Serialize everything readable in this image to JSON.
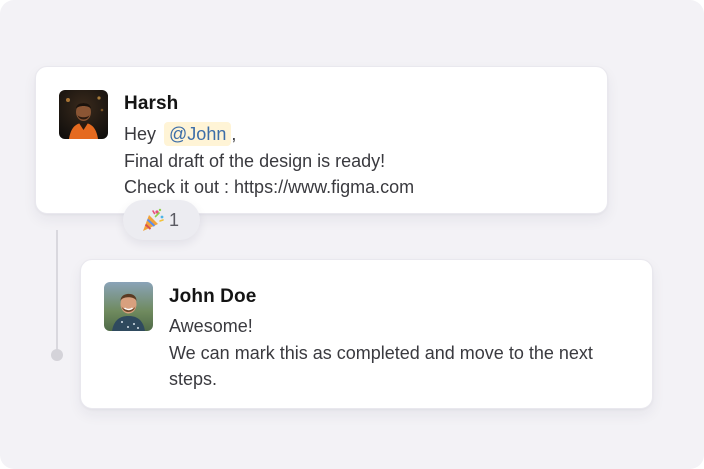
{
  "messages": [
    {
      "author": "Harsh",
      "avatar_icon": "profile-photo-man-dark-background",
      "lines": {
        "greeting": "Hey",
        "mention": "@John",
        "greeting_suffix": ",",
        "line2": "Final draft of the design is ready!",
        "line3": "Check it out : https://www.figma.com"
      },
      "reaction": {
        "emoji": "🎉",
        "emoji_name": "party-popper-icon",
        "count": "1"
      }
    },
    {
      "author": "John Doe",
      "avatar_icon": "profile-photo-man-smiling-outdoors",
      "lines": {
        "line1": "Awesome!",
        "line2": "We can mark this as completed and move to the next steps."
      }
    }
  ],
  "colors": {
    "background": "#f3f2f6",
    "card": "#ffffff",
    "mention_bg": "#fff4d6",
    "mention_text": "#3c6da8",
    "reaction_bg": "#ececf1",
    "thread_line": "#d9d8de"
  }
}
